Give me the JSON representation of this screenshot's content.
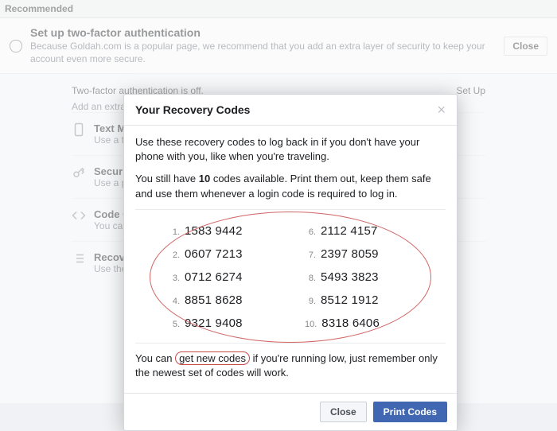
{
  "recommended_label": "Recommended",
  "banner": {
    "title": "Set up two-factor authentication",
    "subtitle": "Because Goldah.com is a popular page, we recommend that you add an extra layer of security to keep your account even more secure.",
    "close": "Close"
  },
  "twofa": {
    "status": "Two-factor authentication is off.",
    "setup": "Set Up",
    "add_extra": "Add an extra layer of security to keep your account",
    "sections": {
      "text": {
        "title": "Text Messages",
        "sub": "Use a text message to get login codes from lo"
      },
      "key": {
        "title": "Security Keys",
        "sub": "Use a physical security key via USB or NFC"
      },
      "code": {
        "title": "Code Generator",
        "sub": "You can use a third-party app to generate your login codes"
      },
      "recovery": {
        "title": "Recovery Codes",
        "sub": "Use these when you don't have your phone"
      }
    }
  },
  "modal": {
    "title": "Your Recovery Codes",
    "p1": "Use these recovery codes to log back in if you don't have your phone with you, like when you're traveling.",
    "p2a": "You still have ",
    "p2b_count": "10",
    "p2c": " codes available. Print them out, keep them safe and use them whenever a login code is required to log in.",
    "p3a": "You can ",
    "p3b_link": "get new codes",
    "p3c": " if you're running low, just remember only the newest set of codes will work.",
    "close": "Close",
    "print": "Print Codes",
    "codes": [
      {
        "n": "1.",
        "v": "1583 9442"
      },
      {
        "n": "2.",
        "v": "0607 7213"
      },
      {
        "n": "3.",
        "v": "0712 6274"
      },
      {
        "n": "4.",
        "v": "8851 8628"
      },
      {
        "n": "5.",
        "v": "9321 9408"
      },
      {
        "n": "6.",
        "v": "2112 4157"
      },
      {
        "n": "7.",
        "v": "2397 8059"
      },
      {
        "n": "8.",
        "v": "5493 3823"
      },
      {
        "n": "9.",
        "v": "8512 1912"
      },
      {
        "n": "10.",
        "v": "8318 6406"
      }
    ]
  }
}
